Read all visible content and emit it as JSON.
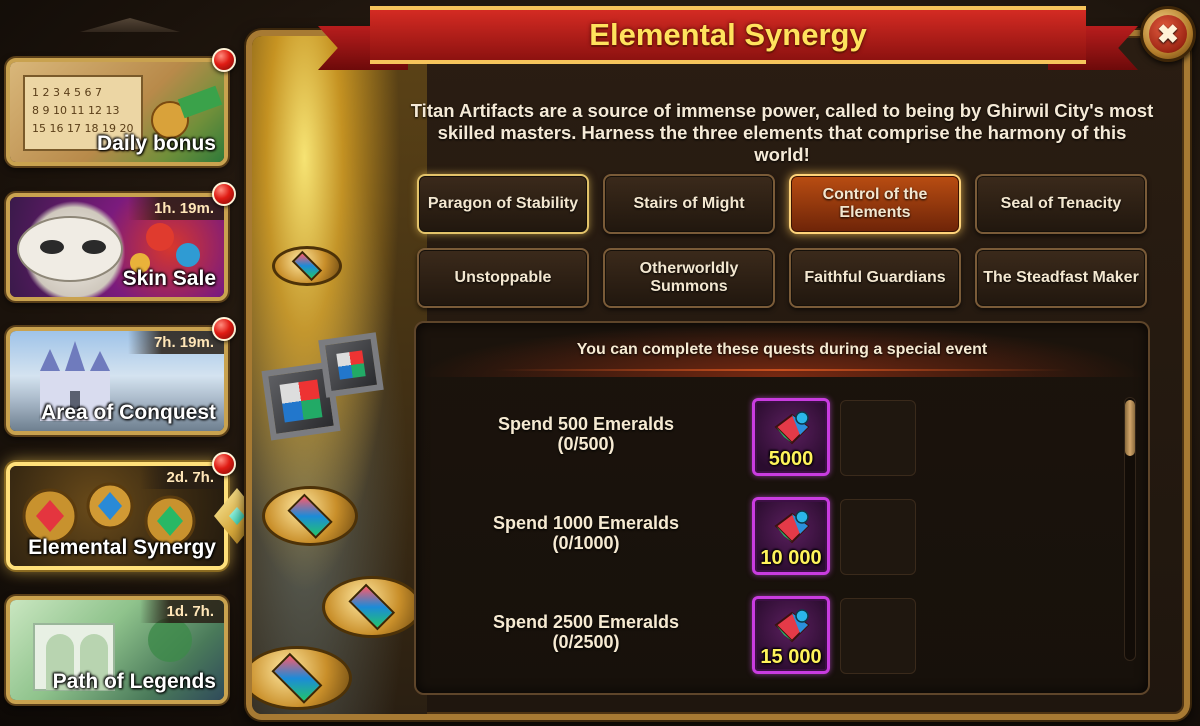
{
  "sidebar": {
    "events": [
      {
        "label": "Daily bonus",
        "timer": "",
        "notification": true,
        "active": false
      },
      {
        "label": "Skin Sale",
        "timer": "1h. 19m.",
        "notification": true,
        "active": false
      },
      {
        "label": "Area of Conquest",
        "timer": "7h. 19m.",
        "notification": true,
        "active": false
      },
      {
        "label": "Elemental Synergy",
        "timer": "2d. 7h.",
        "notification": true,
        "active": true
      },
      {
        "label": "Path of Legends",
        "timer": "1d. 7h.",
        "notification": false,
        "active": false
      }
    ]
  },
  "window": {
    "title": "Elemental Synergy",
    "close_label": "✖",
    "description": "Titan Artifacts are a source of immense power, called to being by Ghirwil City's most skilled masters. Harness the three elements that comprise the harmony of this world!"
  },
  "tabs": [
    {
      "label": "Paragon of Stability",
      "state": "glow"
    },
    {
      "label": "Stairs of Might",
      "state": "normal"
    },
    {
      "label": "Control of the Elements",
      "state": "selected"
    },
    {
      "label": "Seal of Tenacity",
      "state": "normal"
    },
    {
      "label": "Unstoppable",
      "state": "normal"
    },
    {
      "label": "Otherworldly Summons",
      "state": "normal"
    },
    {
      "label": "Faithful Guardians",
      "state": "normal"
    },
    {
      "label": "The Steadfast Maker",
      "state": "normal"
    }
  ],
  "quests": {
    "header": "You can complete these quests during a special event",
    "items": [
      {
        "title": "Spend 500 Emeralds",
        "progress": "(0/500)",
        "reward_amount": "5000"
      },
      {
        "title": "Spend 1000 Emeralds",
        "progress": "(0/1000)",
        "reward_amount": "10 000"
      },
      {
        "title": "Spend 2500 Emeralds",
        "progress": "(0/2500)",
        "reward_amount": "15 000"
      }
    ]
  },
  "colors": {
    "title_text": "#ffe35d",
    "ribbon": "#d42b23",
    "frame_gold": "#c9a24f",
    "reward_border": "#c93ce0",
    "notification": "#e01c14"
  },
  "icons": {
    "close": "close-icon",
    "reward": "artifact-essence-icon",
    "notification": "notification-dot-icon"
  }
}
